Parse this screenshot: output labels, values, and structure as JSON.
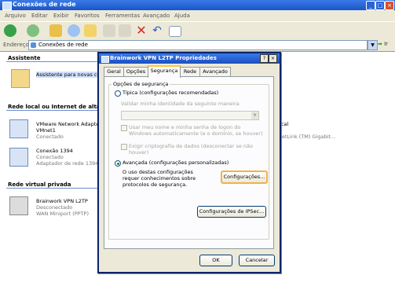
{
  "window": {
    "title": "Conexões de rede",
    "controls": [
      "_",
      "□",
      "×"
    ]
  },
  "menu": [
    "Arquivo",
    "Editar",
    "Exibir",
    "Favoritos",
    "Ferramentas",
    "Avançado",
    "Ajuda"
  ],
  "address": {
    "label": "Endereço",
    "value": "Conexões de rede",
    "go_label": "Ir"
  },
  "content": {
    "assistant_header": "Assistente",
    "assistant_item": "Assistente para novas co",
    "lan_header": "Rede local ou Internet de alta v",
    "lan_items": [
      {
        "name": "VMware Network Adapter",
        "sub1": "VMnet1",
        "sub2": "Conectado"
      },
      {
        "name": "Conexão 1394",
        "sub1": "Conectado",
        "sub2": "Adaptador de rede 1394"
      }
    ],
    "right_partial_1": "ocal",
    "right_partial_2": "NetLink (TM) Gigabit...",
    "vpn_header": "Rede virtual privada",
    "vpn_item": {
      "name": "Brainwork VPN L2TP",
      "sub1": "Desconectado",
      "sub2": "WAN Miniport (PPTP)"
    }
  },
  "dialog": {
    "title": "Brainwork VPN L2TP Propriedades",
    "help_btn": "?",
    "close_btn": "×",
    "tabs": [
      "Geral",
      "Opções",
      "Segurança",
      "Rede",
      "Avançado"
    ],
    "active_tab": "Segurança",
    "group_label": "Opções de segurança",
    "typical_label": "Típica (configurações recomendadas)",
    "validate_label": "Validar minha identidade da seguinte maneira",
    "auto_logon_label_1": "Usar meu nome e minha senha de logon do",
    "auto_logon_label_2": "Windows automaticamente (e o domínio, se houver)",
    "encrypt_label_1": "Exigir criptografia de dados (desconectar se não",
    "encrypt_label_2": "houver)",
    "advanced_label": "Avançada (configurações personalizadas)",
    "advanced_desc_1": "O uso destas configurações",
    "advanced_desc_2": "requer conhecimentos sobre",
    "advanced_desc_3": "protocolos de segurança.",
    "settings_btn": "Configurações...",
    "ipsec_btn": "Configurações de IPSec...",
    "ok_btn": "OK",
    "cancel_btn": "Cancelar"
  }
}
